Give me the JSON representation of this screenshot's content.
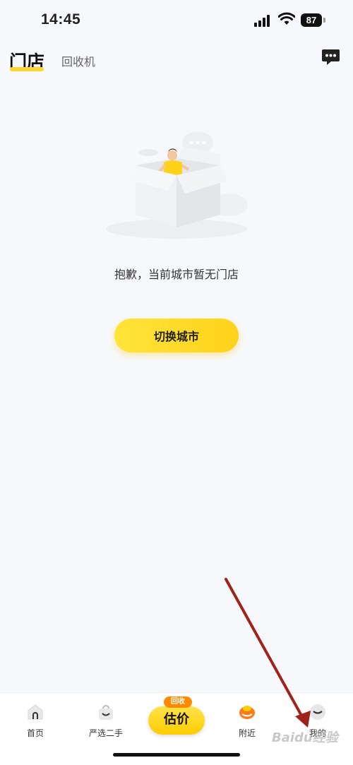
{
  "status_bar": {
    "time": "14:45",
    "battery": "87"
  },
  "header": {
    "active_tab": "门店",
    "other_tab": "回收机",
    "message_icon": "chat-icon"
  },
  "empty_state": {
    "message": "抱歉，当前城市暂无门店",
    "button_label": "切换城市"
  },
  "tabbar": {
    "items": [
      {
        "label": "首页",
        "icon": "home-icon"
      },
      {
        "label": "严选二手",
        "icon": "bag-icon"
      },
      {
        "label": "附近",
        "icon": "nearby-icon"
      },
      {
        "label": "我的",
        "icon": "profile-icon"
      }
    ],
    "center": {
      "badge": "回收",
      "label": "估价"
    }
  },
  "watermark": "Baidu经验",
  "colors": {
    "accent": "#ffd62b",
    "annotation_arrow": "#a0231a"
  }
}
